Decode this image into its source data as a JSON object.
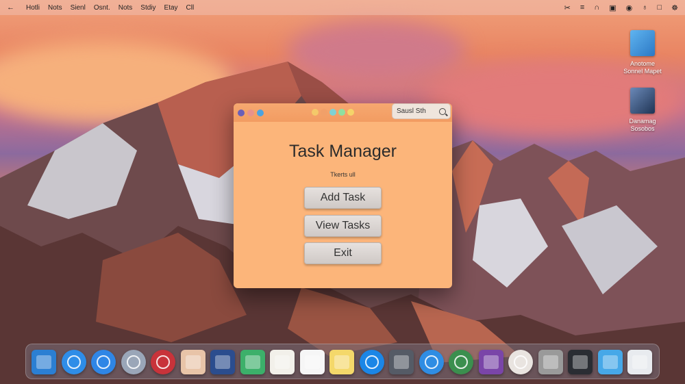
{
  "menubar": {
    "apple_glyph": "←",
    "items": [
      "Hotli",
      "Nots",
      "Sienl",
      "Osnt.",
      "Nots",
      "Stdiy",
      "Etay",
      "Cll"
    ],
    "status_icons": [
      "back-arrow-icon",
      "battery-icon",
      "arch-icon",
      "display-icon",
      "gamepad-icon",
      "bulb-icon",
      "document-icon",
      "gear-icon"
    ],
    "status_glyphs": [
      "✂",
      "≡",
      "∩",
      "▣",
      "◉",
      "♁",
      "□",
      "☸"
    ]
  },
  "desktop": {
    "icons": [
      {
        "name": "desktop-icon-1",
        "label_1": "Anotome",
        "label_2": "Sonnel Mapet",
        "color": "#3a8fd6"
      },
      {
        "name": "desktop-icon-2",
        "label_1": "Danamag",
        "label_2": "Sosobos",
        "color": "#2f4f7a"
      }
    ]
  },
  "window": {
    "search": {
      "label": "Sausl Sth"
    },
    "title": "Task Manager",
    "subtitle": "Tkerts ull",
    "buttons": [
      {
        "name": "add-task-button",
        "label": "Add Task"
      },
      {
        "name": "view-tasks-button",
        "label": "View Tasks"
      },
      {
        "name": "exit-button",
        "label": "Exit"
      }
    ],
    "traffic_colors": [
      "#6a5fb8",
      "#e8928c",
      "#4ba3e0"
    ],
    "center_dot_colors": [
      "#f4c96a",
      "#f1a069",
      "#7fd2d3",
      "#8fe0a0",
      "#f4d46a"
    ]
  },
  "dock": {
    "apps": [
      {
        "name": "finder-icon",
        "color": "#2b7fd3",
        "shape": "sq"
      },
      {
        "name": "safari-icon",
        "color": "#2e8de8",
        "shape": "round"
      },
      {
        "name": "compass-icon",
        "color": "#2f86e6",
        "shape": "round"
      },
      {
        "name": "rocket-icon",
        "color": "#9aa6b8",
        "shape": "round"
      },
      {
        "name": "record-icon",
        "color": "#c8333a",
        "shape": "round"
      },
      {
        "name": "photos-icon",
        "color": "#e8c4a8",
        "shape": "sq"
      },
      {
        "name": "maps-icon",
        "color": "#2b4d8e",
        "shape": "sq"
      },
      {
        "name": "messages-icon",
        "color": "#3cb06a",
        "shape": "sq"
      },
      {
        "name": "notes-list-icon",
        "color": "#f2f0ea",
        "shape": "sq"
      },
      {
        "name": "calendar-icon",
        "color": "#f6f6f6",
        "shape": "sq"
      },
      {
        "name": "notes-icon",
        "color": "#f4d86a",
        "shape": "sq"
      },
      {
        "name": "appstore-icon",
        "color": "#1b86e6",
        "shape": "round"
      },
      {
        "name": "menu-app-icon",
        "color": "#555b66",
        "shape": "sq"
      },
      {
        "name": "twitter-icon",
        "color": "#2f8de3",
        "shape": "round"
      },
      {
        "name": "globe-icon",
        "color": "#3b8f4e",
        "shape": "round"
      },
      {
        "name": "purple-app-icon",
        "color": "#7a45a8",
        "shape": "sq"
      },
      {
        "name": "avatar-app-icon",
        "color": "#e9e4e0",
        "shape": "round"
      },
      {
        "name": "system-preferences-icon",
        "color": "#9a9a9a",
        "shape": "sq"
      },
      {
        "name": "terminal-icon",
        "color": "#2a2d33",
        "shape": "sq"
      },
      {
        "name": "folder-icon",
        "color": "#46a8e8",
        "shape": "sq"
      },
      {
        "name": "document-icon",
        "color": "#e8ebef",
        "shape": "sq"
      }
    ]
  }
}
